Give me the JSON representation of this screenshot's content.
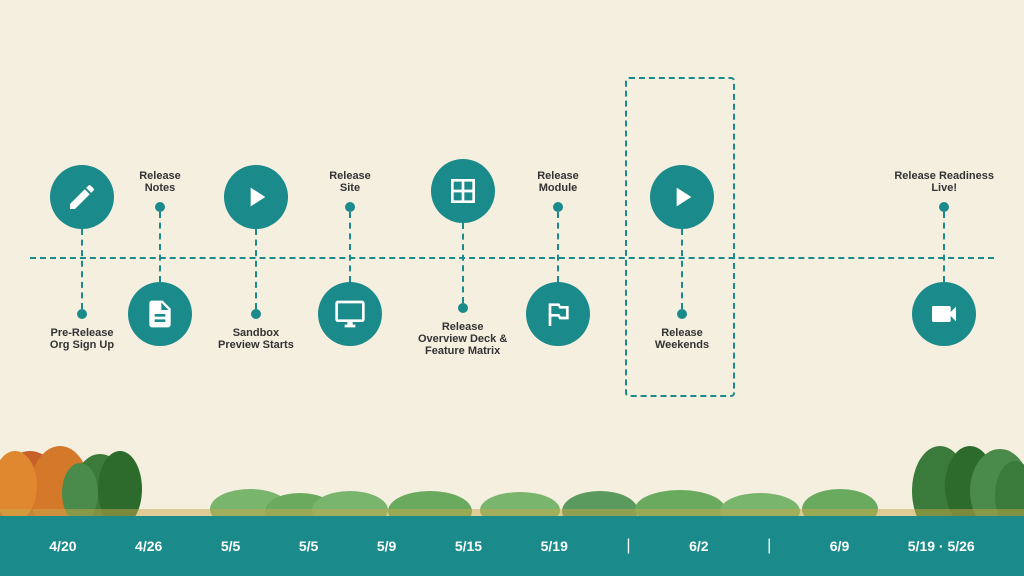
{
  "background_color": "#f5efe0",
  "teal_color": "#1a8a8a",
  "timeline_items": [
    {
      "id": "pre-release",
      "label": "Pre-Release\nOrg Sign Up",
      "position": "top",
      "icon": "pencil",
      "date": "4/20",
      "x_pct": 5
    },
    {
      "id": "release-notes",
      "label": "Release\nNotes",
      "position": "bottom",
      "icon": "document",
      "date": "4/26",
      "x_pct": 14
    },
    {
      "id": "sandbox-preview",
      "label": "Sandbox\nPreview Starts",
      "position": "top",
      "icon": "play",
      "date": "5/5",
      "x_pct": 23
    },
    {
      "id": "release-site",
      "label": "Release\nSite",
      "position": "bottom",
      "icon": "monitor",
      "date": "5/5",
      "x_pct": 33
    },
    {
      "id": "release-overview",
      "label": "Release\nOverview Deck &\nFeature Matrix",
      "position": "top",
      "icon": "grid",
      "date": "5/9",
      "x_pct": 43
    },
    {
      "id": "release-module",
      "label": "Release\nModule",
      "position": "bottom",
      "icon": "mountain",
      "date": "5/15",
      "x_pct": 54
    },
    {
      "id": "release-weekends",
      "label": "Release\nWeekends",
      "position": "top",
      "icon": "play",
      "date": "5/19 | 6/2 | 6/9",
      "x_pct": 69
    },
    {
      "id": "release-readiness",
      "label": "Release Readiness\nLive!",
      "position": "bottom",
      "icon": "video",
      "date": "5/19 - 5/26",
      "x_pct": 88
    }
  ],
  "dates": [
    "4/20",
    "4/26",
    "5/5",
    "5/5",
    "5/9",
    "5/15",
    "5/19",
    "|",
    "6/2",
    "|",
    "6/9",
    "5/19 · 5/26"
  ]
}
